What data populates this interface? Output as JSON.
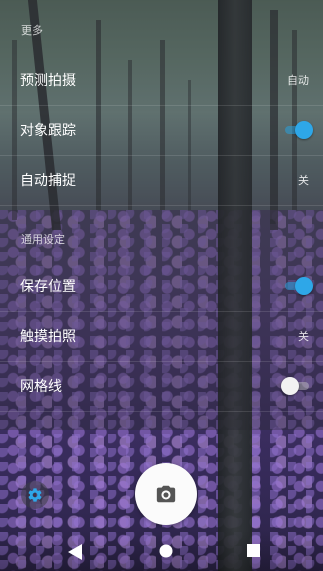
{
  "settings": {
    "section_more": "更多",
    "section_general": "通用设定",
    "rows": [
      {
        "label": "预测拍摄",
        "value": "自动"
      },
      {
        "label": "对象跟踪",
        "toggle": true
      },
      {
        "label": "自动捕捉",
        "value": "关"
      },
      {
        "label": "保存位置",
        "toggle": true
      },
      {
        "label": "触摸拍照",
        "value": "关"
      },
      {
        "label": "网格线",
        "toggle": false
      }
    ]
  },
  "icons": {
    "settings_button": "gear-icon",
    "shutter_button": "camera-icon",
    "nav_back": "back-triangle-icon",
    "nav_home": "home-circle-icon",
    "nav_recents": "recents-square-icon"
  },
  "colors": {
    "accent": "#2ea7e8",
    "settings_icon": "#2ea7e8"
  }
}
